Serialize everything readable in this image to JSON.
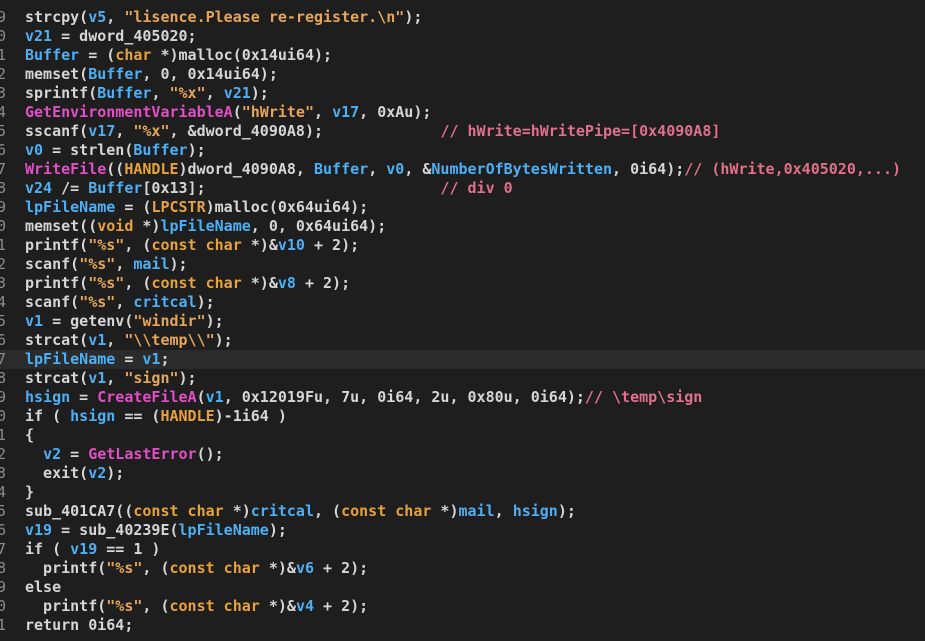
{
  "theme": {
    "background": "#1e1e1e",
    "text": "#d6d6d6",
    "variable": "#4db0f5",
    "string": "#e5a55a",
    "type_keyword": "#e8a23c",
    "api_function": "#e24fc6",
    "comment": "#e0708c",
    "line_number": "#8c8c8c",
    "highlight_row": "#2b2b2b"
  },
  "code": {
    "highlighted_line_index": 18,
    "lines": [
      {
        "num": "9",
        "tokens": [
          {
            "text": "strcpy(",
            "kind": "t"
          },
          {
            "text": "v5",
            "kind": "v"
          },
          {
            "text": ", ",
            "kind": "t"
          },
          {
            "text": "\"lisence.Please re-register.\\n\"",
            "kind": "s"
          },
          {
            "text": ");",
            "kind": "t"
          }
        ]
      },
      {
        "num": "0",
        "tokens": [
          {
            "text": "v21",
            "kind": "v"
          },
          {
            "text": " = dword_405020;",
            "kind": "t"
          }
        ]
      },
      {
        "num": "1",
        "tokens": [
          {
            "text": "Buffer",
            "kind": "v"
          },
          {
            "text": " = (",
            "kind": "t"
          },
          {
            "text": "char",
            "kind": "k"
          },
          {
            "text": " *)malloc(0x14ui64);",
            "kind": "t"
          }
        ]
      },
      {
        "num": "2",
        "tokens": [
          {
            "text": "memset(",
            "kind": "t"
          },
          {
            "text": "Buffer",
            "kind": "v"
          },
          {
            "text": ", 0, 0x14ui64);",
            "kind": "t"
          }
        ]
      },
      {
        "num": "3",
        "tokens": [
          {
            "text": "sprintf(",
            "kind": "t"
          },
          {
            "text": "Buffer",
            "kind": "v"
          },
          {
            "text": ", ",
            "kind": "t"
          },
          {
            "text": "\"%x\"",
            "kind": "s"
          },
          {
            "text": ", ",
            "kind": "t"
          },
          {
            "text": "v21",
            "kind": "v"
          },
          {
            "text": ");",
            "kind": "t"
          }
        ]
      },
      {
        "num": "4",
        "tokens": [
          {
            "text": "GetEnvironmentVariableA",
            "kind": "f"
          },
          {
            "text": "(",
            "kind": "t"
          },
          {
            "text": "\"hWrite\"",
            "kind": "s"
          },
          {
            "text": ", ",
            "kind": "t"
          },
          {
            "text": "v17",
            "kind": "v"
          },
          {
            "text": ", 0xAu);",
            "kind": "t"
          }
        ]
      },
      {
        "num": "5",
        "tokens": [
          {
            "text": "sscanf(",
            "kind": "t"
          },
          {
            "text": "v17",
            "kind": "v"
          },
          {
            "text": ", ",
            "kind": "t"
          },
          {
            "text": "\"%x\"",
            "kind": "s"
          },
          {
            "text": ", &dword_4090A8);             ",
            "kind": "t"
          },
          {
            "text": "// hWrite=hWritePipe=[0x4090A8]",
            "kind": "c"
          }
        ]
      },
      {
        "num": "6",
        "tokens": [
          {
            "text": "v0",
            "kind": "v"
          },
          {
            "text": " = strlen(",
            "kind": "t"
          },
          {
            "text": "Buffer",
            "kind": "v"
          },
          {
            "text": ");",
            "kind": "t"
          }
        ]
      },
      {
        "num": "7",
        "tokens": [
          {
            "text": "WriteFile",
            "kind": "f"
          },
          {
            "text": "((",
            "kind": "t"
          },
          {
            "text": "HANDLE",
            "kind": "k"
          },
          {
            "text": ")dword_4090A8, ",
            "kind": "t"
          },
          {
            "text": "Buffer",
            "kind": "v"
          },
          {
            "text": ", ",
            "kind": "t"
          },
          {
            "text": "v0",
            "kind": "v"
          },
          {
            "text": ", &",
            "kind": "t"
          },
          {
            "text": "NumberOfBytesWritten",
            "kind": "v"
          },
          {
            "text": ", 0i64);",
            "kind": "t"
          },
          {
            "text": "// (hWrite,0x405020,...)",
            "kind": "c"
          }
        ]
      },
      {
        "num": "8",
        "tokens": [
          {
            "text": "v24",
            "kind": "v"
          },
          {
            "text": " /= ",
            "kind": "t"
          },
          {
            "text": "Buffer",
            "kind": "v"
          },
          {
            "text": "[0x13];                          ",
            "kind": "t"
          },
          {
            "text": "// div 0",
            "kind": "c"
          }
        ]
      },
      {
        "num": "9",
        "tokens": [
          {
            "text": "lpFileName",
            "kind": "v"
          },
          {
            "text": " = (",
            "kind": "t"
          },
          {
            "text": "LPCSTR",
            "kind": "k"
          },
          {
            "text": ")malloc(0x64ui64);",
            "kind": "t"
          }
        ]
      },
      {
        "num": "0",
        "tokens": [
          {
            "text": "memset((",
            "kind": "t"
          },
          {
            "text": "void",
            "kind": "k"
          },
          {
            "text": " *)",
            "kind": "t"
          },
          {
            "text": "lpFileName",
            "kind": "v"
          },
          {
            "text": ", 0, 0x64ui64);",
            "kind": "t"
          }
        ]
      },
      {
        "num": "1",
        "tokens": [
          {
            "text": "printf(",
            "kind": "t"
          },
          {
            "text": "\"%s\"",
            "kind": "s"
          },
          {
            "text": ", (",
            "kind": "t"
          },
          {
            "text": "const char",
            "kind": "k"
          },
          {
            "text": " *)&",
            "kind": "t"
          },
          {
            "text": "v10",
            "kind": "v"
          },
          {
            "text": " + 2);",
            "kind": "t"
          }
        ]
      },
      {
        "num": "2",
        "tokens": [
          {
            "text": "scanf(",
            "kind": "t"
          },
          {
            "text": "\"%s\"",
            "kind": "s"
          },
          {
            "text": ", ",
            "kind": "t"
          },
          {
            "text": "mail",
            "kind": "v"
          },
          {
            "text": ");",
            "kind": "t"
          }
        ]
      },
      {
        "num": "3",
        "tokens": [
          {
            "text": "printf(",
            "kind": "t"
          },
          {
            "text": "\"%s\"",
            "kind": "s"
          },
          {
            "text": ", (",
            "kind": "t"
          },
          {
            "text": "const char",
            "kind": "k"
          },
          {
            "text": " *)&",
            "kind": "t"
          },
          {
            "text": "v8",
            "kind": "v"
          },
          {
            "text": " + 2);",
            "kind": "t"
          }
        ]
      },
      {
        "num": "4",
        "tokens": [
          {
            "text": "scanf(",
            "kind": "t"
          },
          {
            "text": "\"%s\"",
            "kind": "s"
          },
          {
            "text": ", ",
            "kind": "t"
          },
          {
            "text": "critcal",
            "kind": "v"
          },
          {
            "text": ");",
            "kind": "t"
          }
        ]
      },
      {
        "num": "5",
        "tokens": [
          {
            "text": "v1",
            "kind": "v"
          },
          {
            "text": " = getenv(",
            "kind": "t"
          },
          {
            "text": "\"windir\"",
            "kind": "s"
          },
          {
            "text": ");",
            "kind": "t"
          }
        ]
      },
      {
        "num": "6",
        "tokens": [
          {
            "text": "strcat(",
            "kind": "t"
          },
          {
            "text": "v1",
            "kind": "v"
          },
          {
            "text": ", ",
            "kind": "t"
          },
          {
            "text": "\"\\\\temp\\\\\"",
            "kind": "s"
          },
          {
            "text": ");",
            "kind": "t"
          }
        ]
      },
      {
        "num": "7",
        "tokens": [
          {
            "text": "lpFileName",
            "kind": "v"
          },
          {
            "text": " = ",
            "kind": "t"
          },
          {
            "text": "v1",
            "kind": "v"
          },
          {
            "text": ";",
            "kind": "t"
          }
        ]
      },
      {
        "num": "8",
        "tokens": [
          {
            "text": "strcat(",
            "kind": "t"
          },
          {
            "text": "v1",
            "kind": "v"
          },
          {
            "text": ", ",
            "kind": "t"
          },
          {
            "text": "\"sign\"",
            "kind": "s"
          },
          {
            "text": ");",
            "kind": "t"
          }
        ]
      },
      {
        "num": "9",
        "tokens": [
          {
            "text": "hsign",
            "kind": "v"
          },
          {
            "text": " = ",
            "kind": "t"
          },
          {
            "text": "CreateFileA",
            "kind": "f"
          },
          {
            "text": "(",
            "kind": "t"
          },
          {
            "text": "v1",
            "kind": "v"
          },
          {
            "text": ", 0x12019Fu, 7u, 0i64, 2u, 0x80u, 0i64);",
            "kind": "t"
          },
          {
            "text": "// \\temp\\sign",
            "kind": "c"
          }
        ]
      },
      {
        "num": "0",
        "tokens": [
          {
            "text": "if ( ",
            "kind": "t"
          },
          {
            "text": "hsign",
            "kind": "v"
          },
          {
            "text": " == (",
            "kind": "t"
          },
          {
            "text": "HANDLE",
            "kind": "k"
          },
          {
            "text": ")-1i64 )",
            "kind": "t"
          }
        ]
      },
      {
        "num": "1",
        "tokens": [
          {
            "text": "{",
            "kind": "t"
          }
        ]
      },
      {
        "num": "2",
        "tokens": [
          {
            "text": "  ",
            "kind": "t"
          },
          {
            "text": "v2",
            "kind": "v"
          },
          {
            "text": " = ",
            "kind": "t"
          },
          {
            "text": "GetLastError",
            "kind": "f"
          },
          {
            "text": "();",
            "kind": "t"
          }
        ]
      },
      {
        "num": "3",
        "tokens": [
          {
            "text": "  exit(",
            "kind": "t"
          },
          {
            "text": "v2",
            "kind": "v"
          },
          {
            "text": ");",
            "kind": "t"
          }
        ]
      },
      {
        "num": "4",
        "tokens": [
          {
            "text": "}",
            "kind": "t"
          }
        ]
      },
      {
        "num": "5",
        "tokens": [
          {
            "text": "sub_401CA7((",
            "kind": "t"
          },
          {
            "text": "const char",
            "kind": "k"
          },
          {
            "text": " *)",
            "kind": "t"
          },
          {
            "text": "critcal",
            "kind": "v"
          },
          {
            "text": ", (",
            "kind": "t"
          },
          {
            "text": "const char",
            "kind": "k"
          },
          {
            "text": " *)",
            "kind": "t"
          },
          {
            "text": "mail",
            "kind": "v"
          },
          {
            "text": ", ",
            "kind": "t"
          },
          {
            "text": "hsign",
            "kind": "v"
          },
          {
            "text": ");",
            "kind": "t"
          }
        ]
      },
      {
        "num": "6",
        "tokens": [
          {
            "text": "v19",
            "kind": "v"
          },
          {
            "text": " = sub_40239E(",
            "kind": "t"
          },
          {
            "text": "lpFileName",
            "kind": "v"
          },
          {
            "text": ");",
            "kind": "t"
          }
        ]
      },
      {
        "num": "7",
        "tokens": [
          {
            "text": "if ( ",
            "kind": "t"
          },
          {
            "text": "v19",
            "kind": "v"
          },
          {
            "text": " == 1 )",
            "kind": "t"
          }
        ]
      },
      {
        "num": "8",
        "tokens": [
          {
            "text": "  printf(",
            "kind": "t"
          },
          {
            "text": "\"%s\"",
            "kind": "s"
          },
          {
            "text": ", (",
            "kind": "t"
          },
          {
            "text": "const char",
            "kind": "k"
          },
          {
            "text": " *)&",
            "kind": "t"
          },
          {
            "text": "v6",
            "kind": "v"
          },
          {
            "text": " + 2);",
            "kind": "t"
          }
        ]
      },
      {
        "num": "9",
        "tokens": [
          {
            "text": "else",
            "kind": "t"
          }
        ]
      },
      {
        "num": "0",
        "tokens": [
          {
            "text": "  printf(",
            "kind": "t"
          },
          {
            "text": "\"%s\"",
            "kind": "s"
          },
          {
            "text": ", (",
            "kind": "t"
          },
          {
            "text": "const char",
            "kind": "k"
          },
          {
            "text": " *)&",
            "kind": "t"
          },
          {
            "text": "v4",
            "kind": "v"
          },
          {
            "text": " + 2);",
            "kind": "t"
          }
        ]
      },
      {
        "num": "1",
        "tokens": [
          {
            "text": "return 0i64;",
            "kind": "t"
          }
        ]
      }
    ]
  }
}
